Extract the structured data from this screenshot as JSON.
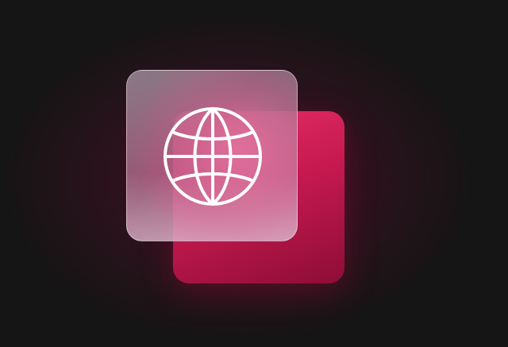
{
  "scene": {
    "icon": "globe-icon",
    "colors": {
      "background": "#151515",
      "glow": "#78143c",
      "back_card_top": "#e8306a",
      "back_card_bottom": "#8d0d37",
      "glass_card": "#c88aa6",
      "icon_stroke": "#ffffff"
    }
  }
}
